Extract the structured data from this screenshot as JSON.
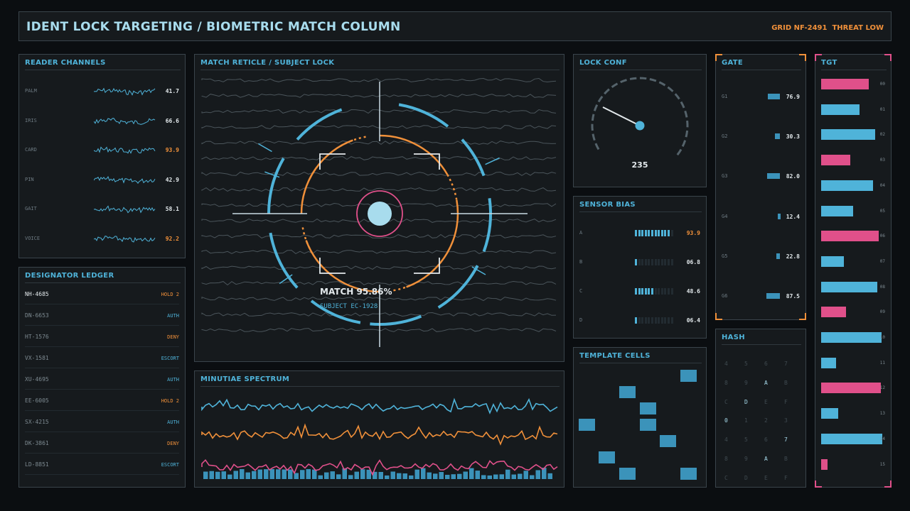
{
  "header": {
    "title": "IDENT LOCK TARGETING / BIOMETRIC MATCH COLUMN",
    "grid": "GRID NF-2491",
    "threat": "THREAT LOW"
  },
  "reader": {
    "title": "READER CHANNELS",
    "items": [
      {
        "label": "PALM",
        "value": "41.7",
        "alert": false
      },
      {
        "label": "IRIS",
        "value": "66.6",
        "alert": false
      },
      {
        "label": "CARD",
        "value": "93.9",
        "alert": true
      },
      {
        "label": "PIN",
        "value": "42.9",
        "alert": false
      },
      {
        "label": "GAIT",
        "value": "58.1",
        "alert": false
      },
      {
        "label": "VOICE",
        "value": "92.2",
        "alert": true
      }
    ]
  },
  "ledger": {
    "title": "DESIGNATOR LEDGER",
    "rows": [
      {
        "id": "NH-4685",
        "status": "HOLD 2",
        "color": "orange"
      },
      {
        "id": "DN-6653",
        "status": "AUTH",
        "color": "cyan"
      },
      {
        "id": "HT-1576",
        "status": "DENY",
        "color": "orange"
      },
      {
        "id": "VX-1581",
        "status": "ESCORT",
        "color": "cyan"
      },
      {
        "id": "XU-4695",
        "status": "AUTH",
        "color": "cyan"
      },
      {
        "id": "EE-6005",
        "status": "HOLD 2",
        "color": "orange"
      },
      {
        "id": "SX-4215",
        "status": "AUTH",
        "color": "cyan"
      },
      {
        "id": "DK-3861",
        "status": "DENY",
        "color": "orange"
      },
      {
        "id": "LD-8851",
        "status": "ESCORT",
        "color": "cyan"
      }
    ]
  },
  "reticle": {
    "title": "MATCH RETICLE / SUBJECT LOCK",
    "match": "MATCH 95.86%",
    "subject": "SUBJECT EC-1928"
  },
  "spectrum": {
    "title": "MINUTIAE SPECTRUM"
  },
  "lockconf": {
    "title": "LOCK CONF",
    "value": "235"
  },
  "bias": {
    "title": "SENSOR BIAS",
    "items": [
      {
        "label": "A",
        "value": "93.9",
        "level": 0.94,
        "alert": true
      },
      {
        "label": "B",
        "value": "06.8",
        "level": 0.07,
        "alert": false
      },
      {
        "label": "C",
        "value": "48.6",
        "level": 0.49,
        "alert": false
      },
      {
        "label": "D",
        "value": "06.4",
        "level": 0.06,
        "alert": false
      }
    ]
  },
  "template": {
    "title": "TEMPLATE CELLS"
  },
  "gate": {
    "title": "GATE",
    "items": [
      {
        "label": "G1",
        "value": "76.9",
        "level": 0.77
      },
      {
        "label": "G2",
        "value": "30.3",
        "level": 0.3
      },
      {
        "label": "G3",
        "value": "82.0",
        "level": 0.82
      },
      {
        "label": "G4",
        "value": "12.4",
        "level": 0.12
      },
      {
        "label": "G5",
        "value": "22.8",
        "level": 0.23
      },
      {
        "label": "G6",
        "value": "87.5",
        "level": 0.88
      }
    ]
  },
  "hash": {
    "title": "HASH",
    "grid": [
      [
        "4",
        "5",
        "6",
        "7"
      ],
      [
        "8",
        "9",
        "A",
        "B"
      ],
      [
        "C",
        "D",
        "E",
        "F"
      ],
      [
        "0",
        "1",
        "2",
        "3"
      ],
      [
        "4",
        "5",
        "6",
        "7"
      ],
      [
        "8",
        "9",
        "A",
        "B"
      ],
      [
        "C",
        "D",
        "E",
        "F"
      ]
    ],
    "bright": [
      "A",
      "D",
      "0",
      "7",
      "A"
    ]
  },
  "tgt": {
    "title": "TGT",
    "items": [
      {
        "label": "00",
        "level": 0.78,
        "color": "pink"
      },
      {
        "label": "01",
        "level": 0.63,
        "color": "cyan"
      },
      {
        "label": "02",
        "level": 0.88,
        "color": "cyan"
      },
      {
        "label": "03",
        "level": 0.48,
        "color": "pink"
      },
      {
        "label": "04",
        "level": 0.85,
        "color": "cyan"
      },
      {
        "label": "05",
        "level": 0.52,
        "color": "cyan"
      },
      {
        "label": "06",
        "level": 0.94,
        "color": "pink"
      },
      {
        "label": "07",
        "level": 0.37,
        "color": "cyan"
      },
      {
        "label": "08",
        "level": 0.92,
        "color": "cyan"
      },
      {
        "label": "09",
        "level": 0.41,
        "color": "pink"
      },
      {
        "label": "10",
        "level": 0.99,
        "color": "cyan"
      },
      {
        "label": "11",
        "level": 0.24,
        "color": "cyan"
      },
      {
        "label": "12",
        "level": 0.98,
        "color": "pink"
      },
      {
        "label": "13",
        "level": 0.28,
        "color": "cyan"
      },
      {
        "label": "14",
        "level": 1.0,
        "color": "cyan"
      },
      {
        "label": "15",
        "level": 0.11,
        "color": "pink"
      }
    ]
  }
}
